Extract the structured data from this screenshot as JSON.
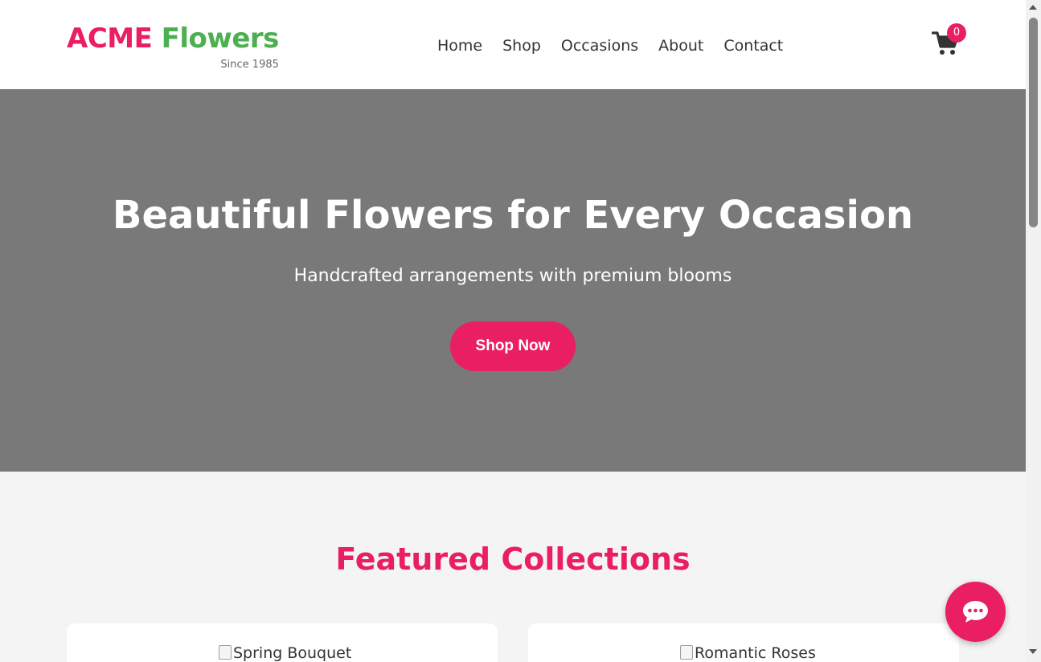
{
  "header": {
    "logo_acme": "ACME",
    "logo_flowers": "Flowers",
    "logo_since": "Since 1985",
    "nav": [
      {
        "label": "Home"
      },
      {
        "label": "Shop"
      },
      {
        "label": "Occasions"
      },
      {
        "label": "About"
      },
      {
        "label": "Contact"
      }
    ],
    "cart_icon": "shopping-cart-icon",
    "cart_count": "0"
  },
  "hero": {
    "title": "Beautiful Flowers for Every Occasion",
    "subtitle": "Handcrafted arrangements with premium blooms",
    "cta_label": "Shop Now"
  },
  "featured": {
    "title": "Featured Collections",
    "cards": [
      {
        "image_alt": "Spring Bouquet"
      },
      {
        "image_alt": "Romantic Roses"
      }
    ]
  },
  "chat": {
    "icon": "chat-bubble-icon"
  },
  "colors": {
    "brand_pink": "#e91e63",
    "brand_green": "#4caf50",
    "hero_bg": "#797979",
    "page_bg": "#f4f4f4"
  }
}
